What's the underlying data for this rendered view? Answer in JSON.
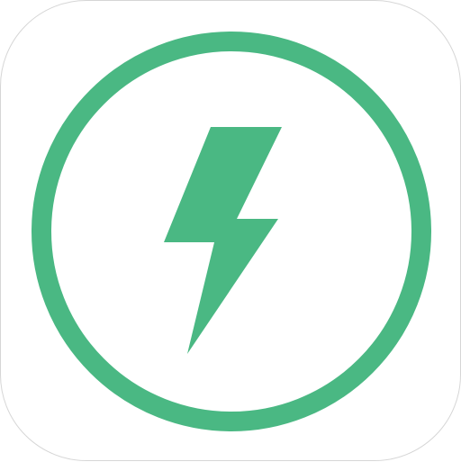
{
  "icon": {
    "name": "lightning-bolt-icon",
    "ring_name": "circle-ring",
    "accent_color": "#4ab883",
    "background_color": "#ffffff",
    "border_color": "#d6d6d6"
  }
}
